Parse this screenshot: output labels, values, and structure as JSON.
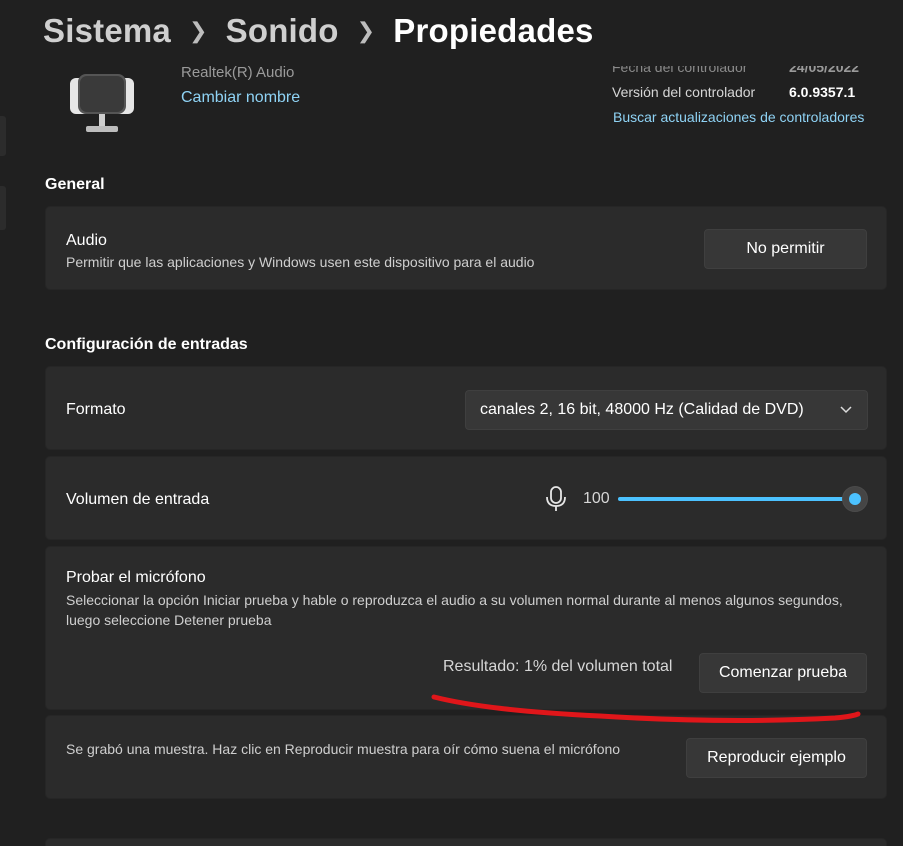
{
  "breadcrumb": {
    "items": [
      "Sistema",
      "Sonido"
    ],
    "current": "Propiedades"
  },
  "device": {
    "name": "Realtek(R) Audio",
    "rename_label": "Cambiar nombre",
    "icon": "microphone-device-icon"
  },
  "driver": {
    "date_label": "Fecha del controlador",
    "date_value": "24/05/2022",
    "version_label": "Versión del controlador",
    "version_value": "6.0.9357.1",
    "update_link": "Buscar actualizaciones de controladores"
  },
  "general": {
    "title": "General",
    "audio": {
      "title": "Audio",
      "description": "Permitir que las aplicaciones y Windows usen este dispositivo para el audio",
      "button_label": "No permitir"
    }
  },
  "input": {
    "title": "Configuración de entradas",
    "format": {
      "label": "Formato",
      "selected": "canales 2, 16 bit, 48000 Hz (Calidad de DVD)"
    },
    "volume": {
      "label": "Volumen de entrada",
      "value": "100",
      "level_fraction": 1.0,
      "icon": "microphone-icon"
    },
    "test": {
      "title": "Probar el micrófono",
      "description": "Seleccionar la opción Iniciar prueba y hable o reproduzca el audio a su volumen normal durante al menos algunos segundos, luego seleccione Detener prueba",
      "result": "Resultado: 1% del volumen total",
      "button_label": "Comenzar prueba"
    },
    "sample": {
      "description": "Se grabó una muestra. Haz clic en Reproducir muestra para oír cómo suena el micrófono",
      "button_label": "Reproducir ejemplo"
    }
  },
  "colors": {
    "background": "#202020",
    "card": "#2b2b2b",
    "accent": "#4cc2ff",
    "link": "#8fd3f5",
    "annotation": "#e0161a"
  }
}
